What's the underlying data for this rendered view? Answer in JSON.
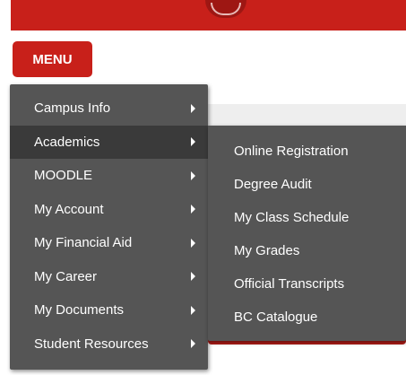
{
  "colors": {
    "brand_red": "#c8201a",
    "menu_bg": "#555555",
    "menu_active_bg": "#3a3a3a",
    "menu_text": "#ffffff"
  },
  "header": {
    "menu_button_label": "MENU",
    "emblem_icon": "crest-emblem-icon"
  },
  "main_menu": {
    "items": [
      {
        "label": "Campus Info",
        "icon": "chevron-right-icon"
      },
      {
        "label": "Academics",
        "icon": "chevron-right-icon"
      },
      {
        "label": "MOODLE",
        "icon": "chevron-right-icon"
      },
      {
        "label": "My Account",
        "icon": "chevron-right-icon"
      },
      {
        "label": "My Financial Aid",
        "icon": "chevron-right-icon"
      },
      {
        "label": "My Career",
        "icon": "chevron-right-icon"
      },
      {
        "label": "My Documents",
        "icon": "chevron-right-icon"
      },
      {
        "label": "Student Resources",
        "icon": "chevron-right-icon"
      }
    ],
    "active_item": "Academics"
  },
  "sub_menu": {
    "parent": "Academics",
    "items": [
      {
        "label": "Online Registration"
      },
      {
        "label": "Degree Audit"
      },
      {
        "label": "My Class Schedule"
      },
      {
        "label": "My Grades"
      },
      {
        "label": "Official Transcripts"
      },
      {
        "label": "BC Catalogue"
      }
    ]
  }
}
